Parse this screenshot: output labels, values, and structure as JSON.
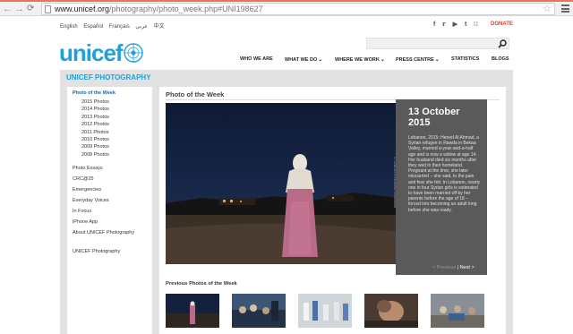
{
  "browser": {
    "url_host": "www.unicef.org",
    "url_path": "/photography/photo_week.php#UNI198627"
  },
  "header": {
    "languages": [
      "English",
      "Español",
      "Français",
      "عربي",
      "中文"
    ],
    "social_icons": [
      "facebook-icon",
      "twitter-icon",
      "youtube-icon",
      "tumblr-icon",
      "rss-icon"
    ],
    "donate_label": "DONATE",
    "logo_text": "unicef",
    "search_placeholder": "",
    "nav": [
      {
        "label": "WHO WE ARE",
        "has_menu": false
      },
      {
        "label": "WHAT WE DO",
        "has_menu": true
      },
      {
        "label": "WHERE WE WORK",
        "has_menu": true
      },
      {
        "label": "PRESS CENTRE",
        "has_menu": true
      },
      {
        "label": "STATISTICS",
        "has_menu": false
      },
      {
        "label": "BLOGS",
        "has_menu": false
      }
    ],
    "brand_color": "#1fa0db",
    "donate_color": "#e03c31"
  },
  "section": {
    "title": "UNICEF PHOTOGRAPHY"
  },
  "sidebar": {
    "active": "Photo of the Week",
    "years": [
      "2015 Photos",
      "2014 Photos",
      "2013 Photos",
      "2012 Photos",
      "2011 Photos",
      "2010 Photos",
      "2009 Photos",
      "2008 Photos"
    ],
    "links": [
      "Photo Essays",
      "CRC@25",
      "Emergencies",
      "Everyday Voices",
      "In Focus",
      "iPhone App",
      "About UNICEF Photography"
    ],
    "footer_link": "UNICEF Photography"
  },
  "main": {
    "title": "Photo of the Week",
    "date": "13 October 2015",
    "caption": "Lebanon, 2015: Hened Al Ahmad, a Syrian refugee in Rawda in Bekaa Valley, married a-year-and-a-half ago and is now a widow at age 14. Her husband died six months after they wed in their homeland. Pregnant at the time, she later miscarried – she said, to the pain and fear she felt. In Lebanon, nearly one in four Syrian girls is estimated to have been married off by her parents before the age of 18 – forced into becoming an adult long before she was ready.",
    "photo_credit": "© UNICEF/UNI198627/Romenzi",
    "prev_label": "< Previous",
    "separator": "|",
    "next_label": "Next >",
    "previous_title": "Previous Photos of the Week",
    "thumbnails": [
      "thumb-night-field",
      "thumb-boat-crowd",
      "thumb-children-group",
      "thumb-child-portrait",
      "thumb-camp-crowd"
    ]
  }
}
